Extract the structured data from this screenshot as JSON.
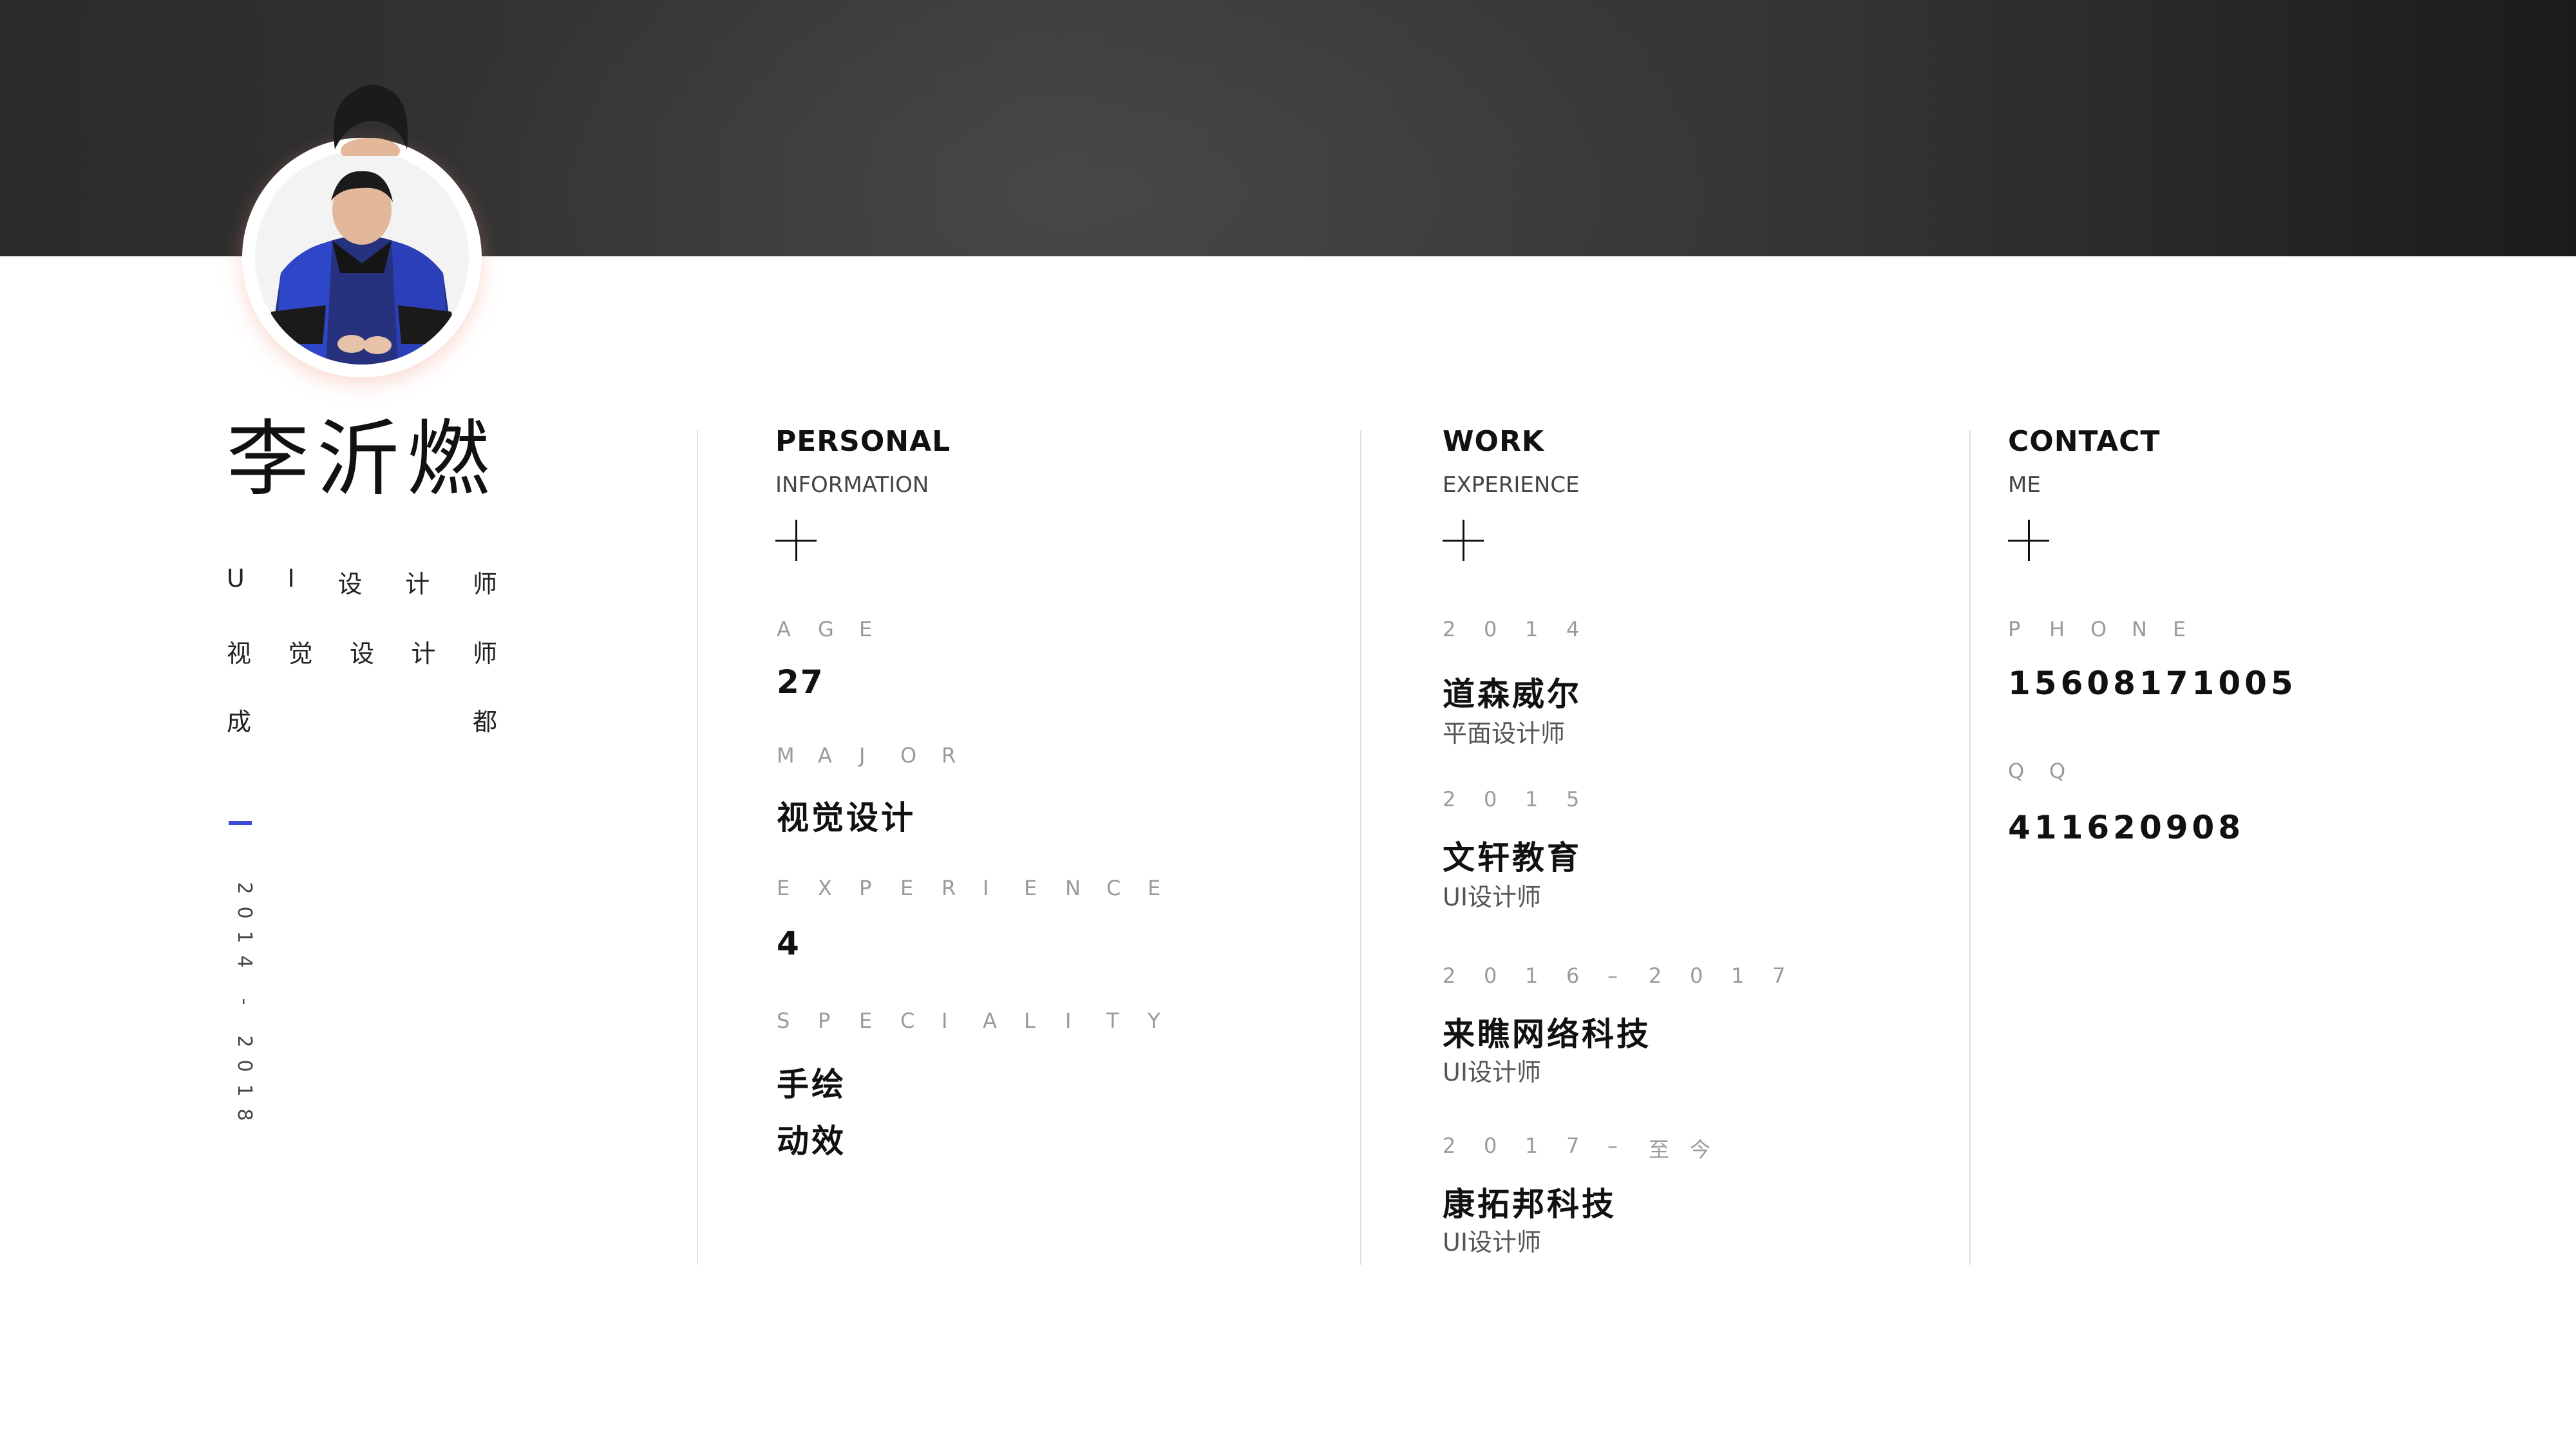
{
  "profile": {
    "name": "李沂燃",
    "title_1": [
      "U",
      "I",
      "设",
      "计",
      "师"
    ],
    "title_2": [
      "视",
      "觉",
      "设",
      "计",
      "师"
    ],
    "location": [
      "成",
      "都"
    ],
    "years": [
      "2",
      "0",
      "1",
      "4",
      "-",
      "2",
      "0",
      "1",
      "8"
    ]
  },
  "personal": {
    "title": "PERSONAL",
    "subtitle": "INFORMATION",
    "age_label": [
      "A",
      "G",
      "E"
    ],
    "age": "27",
    "major_label": [
      "M",
      "A",
      "J",
      "O",
      "R"
    ],
    "major": "视觉设计",
    "experience_label": [
      "E",
      "X",
      "P",
      "E",
      "R",
      "I",
      "E",
      "N",
      "C",
      "E"
    ],
    "experience": "4",
    "speciality_label": [
      "S",
      "P",
      "E",
      "C",
      "I",
      "A",
      "L",
      "I",
      "T",
      "Y"
    ],
    "speciality": [
      "手绘",
      "动效"
    ]
  },
  "work": {
    "title": "WORK",
    "subtitle": "EXPERIENCE",
    "entries": [
      {
        "period": [
          "2",
          "0",
          "1",
          "4"
        ],
        "company": "道森威尔",
        "role": "平面设计师"
      },
      {
        "period": [
          "2",
          "0",
          "1",
          "5"
        ],
        "company": "文轩教育",
        "role": "UI设计师"
      },
      {
        "period": [
          "2",
          "0",
          "1",
          "6",
          "–",
          "2",
          "0",
          "1",
          "7"
        ],
        "company": "来瞧网络科技",
        "role": "UI设计师"
      },
      {
        "period": [
          "2",
          "0",
          "1",
          "7",
          "–",
          "至",
          "今"
        ],
        "company": "康拓邦科技",
        "role": "UI设计师"
      }
    ]
  },
  "contact": {
    "title": "CONTACT",
    "subtitle": "ME",
    "phone_label": [
      "P",
      "H",
      "O",
      "N",
      "E"
    ],
    "phone": "15608171005",
    "qq_label": [
      "Q",
      "Q"
    ],
    "qq": "411620908"
  },
  "colors": {
    "accent": "#3b4bd8",
    "banner": "#333333",
    "jacket": "#2a3fb5"
  }
}
